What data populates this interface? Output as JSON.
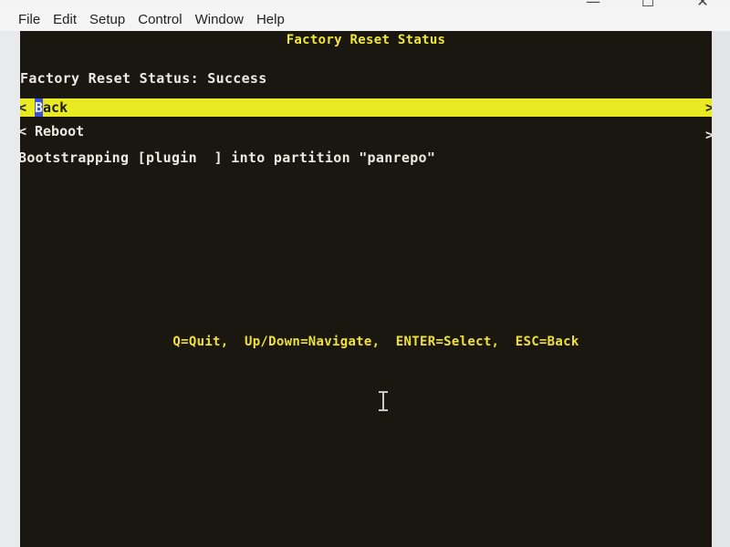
{
  "window": {
    "controls": {
      "minimize": "—",
      "maximize": "☐",
      "close": "✕"
    }
  },
  "menubar": {
    "items": [
      "File",
      "Edit",
      "Setup",
      "Control",
      "Window",
      "Help"
    ]
  },
  "terminal": {
    "title": "Factory Reset Status",
    "status_line": "Factory Reset Status: Success",
    "menu": [
      {
        "chevron": "<",
        "label_first": "B",
        "label_rest": "ack",
        "arrow": ">",
        "selected": true
      },
      {
        "chevron": "<",
        "label": "Reboot",
        "arrow": ">",
        "selected": false
      }
    ],
    "bootstrap_line": "Bootstrapping [plugin  ] into partition \"panrepo\"",
    "help_line": "Q=Quit,  Up/Down=Navigate,  ENTER=Select,  ESC=Back"
  },
  "colors": {
    "terminal_bg": "#19170f",
    "highlight": "#eaea22",
    "title_yellow": "#f2e636",
    "text_white": "#ecebe0",
    "cursor_blue": "#3b4fd8"
  }
}
